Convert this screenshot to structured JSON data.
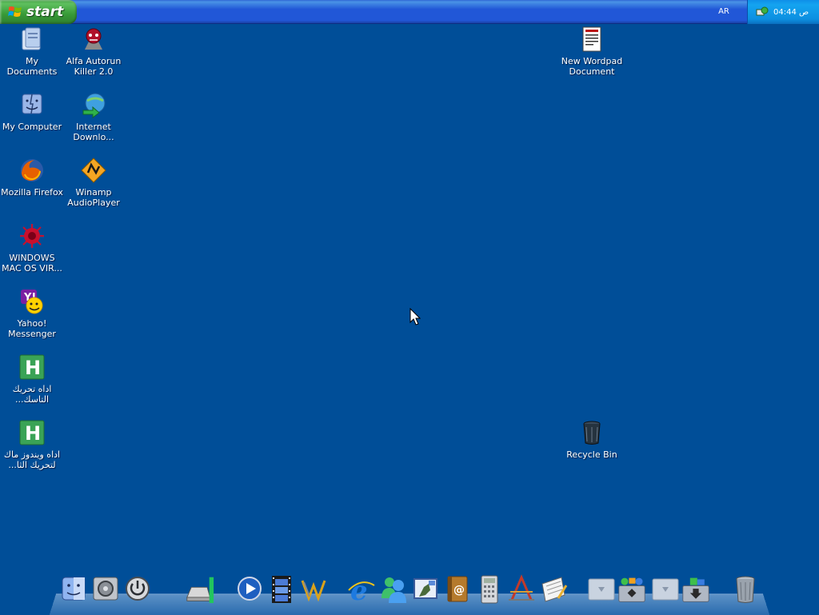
{
  "taskbar": {
    "start_label": "start",
    "language": "AR",
    "clock": "04:44 ص"
  },
  "desktop": {
    "icons": [
      {
        "label": "My Documents",
        "icon": "folder-documents-icon"
      },
      {
        "label": "Alfa Autorun Killer 2.0",
        "icon": "alfa-autorun-killer-icon"
      },
      {
        "label": "My Computer",
        "icon": "mac-finder-computer-icon"
      },
      {
        "label": "Internet Downlo...",
        "icon": "internet-download-manager-icon"
      },
      {
        "label": "Mozilla Firefox",
        "icon": "firefox-icon"
      },
      {
        "label": "Winamp AudioPlayer",
        "icon": "winamp-icon"
      },
      {
        "label": "WINDOWS MAC OS VIR...",
        "icon": "virus-icon"
      },
      {
        "label": "Yahoo! Messenger",
        "icon": "yahoo-messenger-icon"
      },
      {
        "label": "اداه تحريك التاسك...",
        "icon": "green-h-app-icon"
      },
      {
        "label": "اداه ويندوز ماك لتحريك الثا...",
        "icon": "green-h-app-icon"
      },
      {
        "label": "New Wordpad Document",
        "icon": "wordpad-document-icon"
      },
      {
        "label": "Recycle Bin",
        "icon": "recycle-bin-icon"
      }
    ]
  },
  "dock": {
    "items": [
      "finder-icon",
      "system-preferences-icon",
      "power-icon",
      "hard-drive-icon",
      "media-player-icon",
      "video-film-icon",
      "winamp-dock-icon",
      "internet-explorer-icon",
      "messenger-icon",
      "mail-icon",
      "address-book-icon",
      "calculator-icon",
      "text-editor-icon",
      "notepad-icon",
      "stack-icon",
      "windows-apps-stack-icon",
      "stack-icon",
      "downloads-stack-icon",
      "trash-icon"
    ]
  },
  "colors": {
    "desktop": "#004e98",
    "taskbar": "#2157d7",
    "start": "#379a37",
    "tray": "#0c8fe0"
  }
}
